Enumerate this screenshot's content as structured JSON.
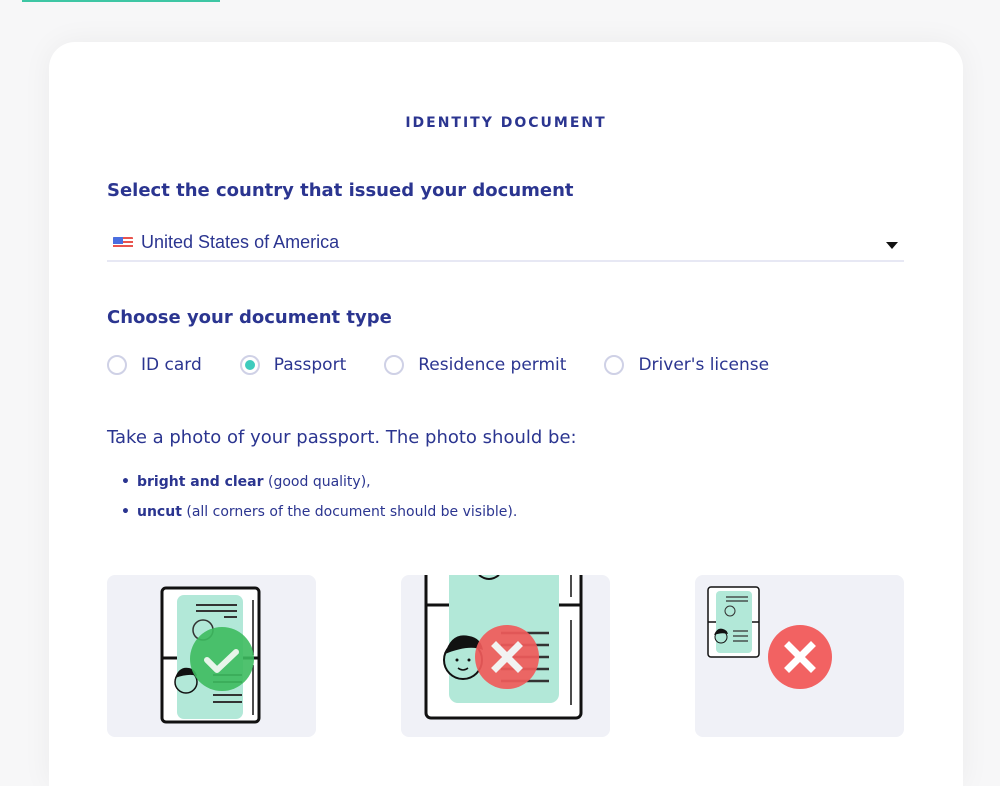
{
  "section_title": "IDENTITY DOCUMENT",
  "country": {
    "label": "Select the country that issued your document",
    "selected_value": "United States of America",
    "flag_icon": "us-flag-icon"
  },
  "document_type": {
    "label": "Choose your document type",
    "options": [
      {
        "label": "ID card",
        "checked": false
      },
      {
        "label": "Passport",
        "checked": true
      },
      {
        "label": "Residence permit",
        "checked": false
      },
      {
        "label": "Driver's license",
        "checked": false
      }
    ]
  },
  "instructions": {
    "intro": "Take a photo of your passport. The photo should be:",
    "bullets": [
      {
        "bold": "bright and clear",
        "rest": " (good quality),"
      },
      {
        "bold": "uncut",
        "rest": " (all corners of the document should be visible)."
      }
    ]
  },
  "examples": [
    {
      "name": "good-example",
      "status": "correct",
      "icon": "check-icon"
    },
    {
      "name": "too-close-example",
      "status": "incorrect",
      "icon": "x-icon"
    },
    {
      "name": "too-far-example",
      "status": "incorrect",
      "icon": "x-icon"
    }
  ],
  "colors": {
    "primary_text": "#2b3590",
    "accent": "#3ecbbd",
    "success": "#3dbb5f",
    "error": "#f05a5a",
    "document_fill": "#b2e8d8",
    "example_bg": "#f0f1f7"
  }
}
